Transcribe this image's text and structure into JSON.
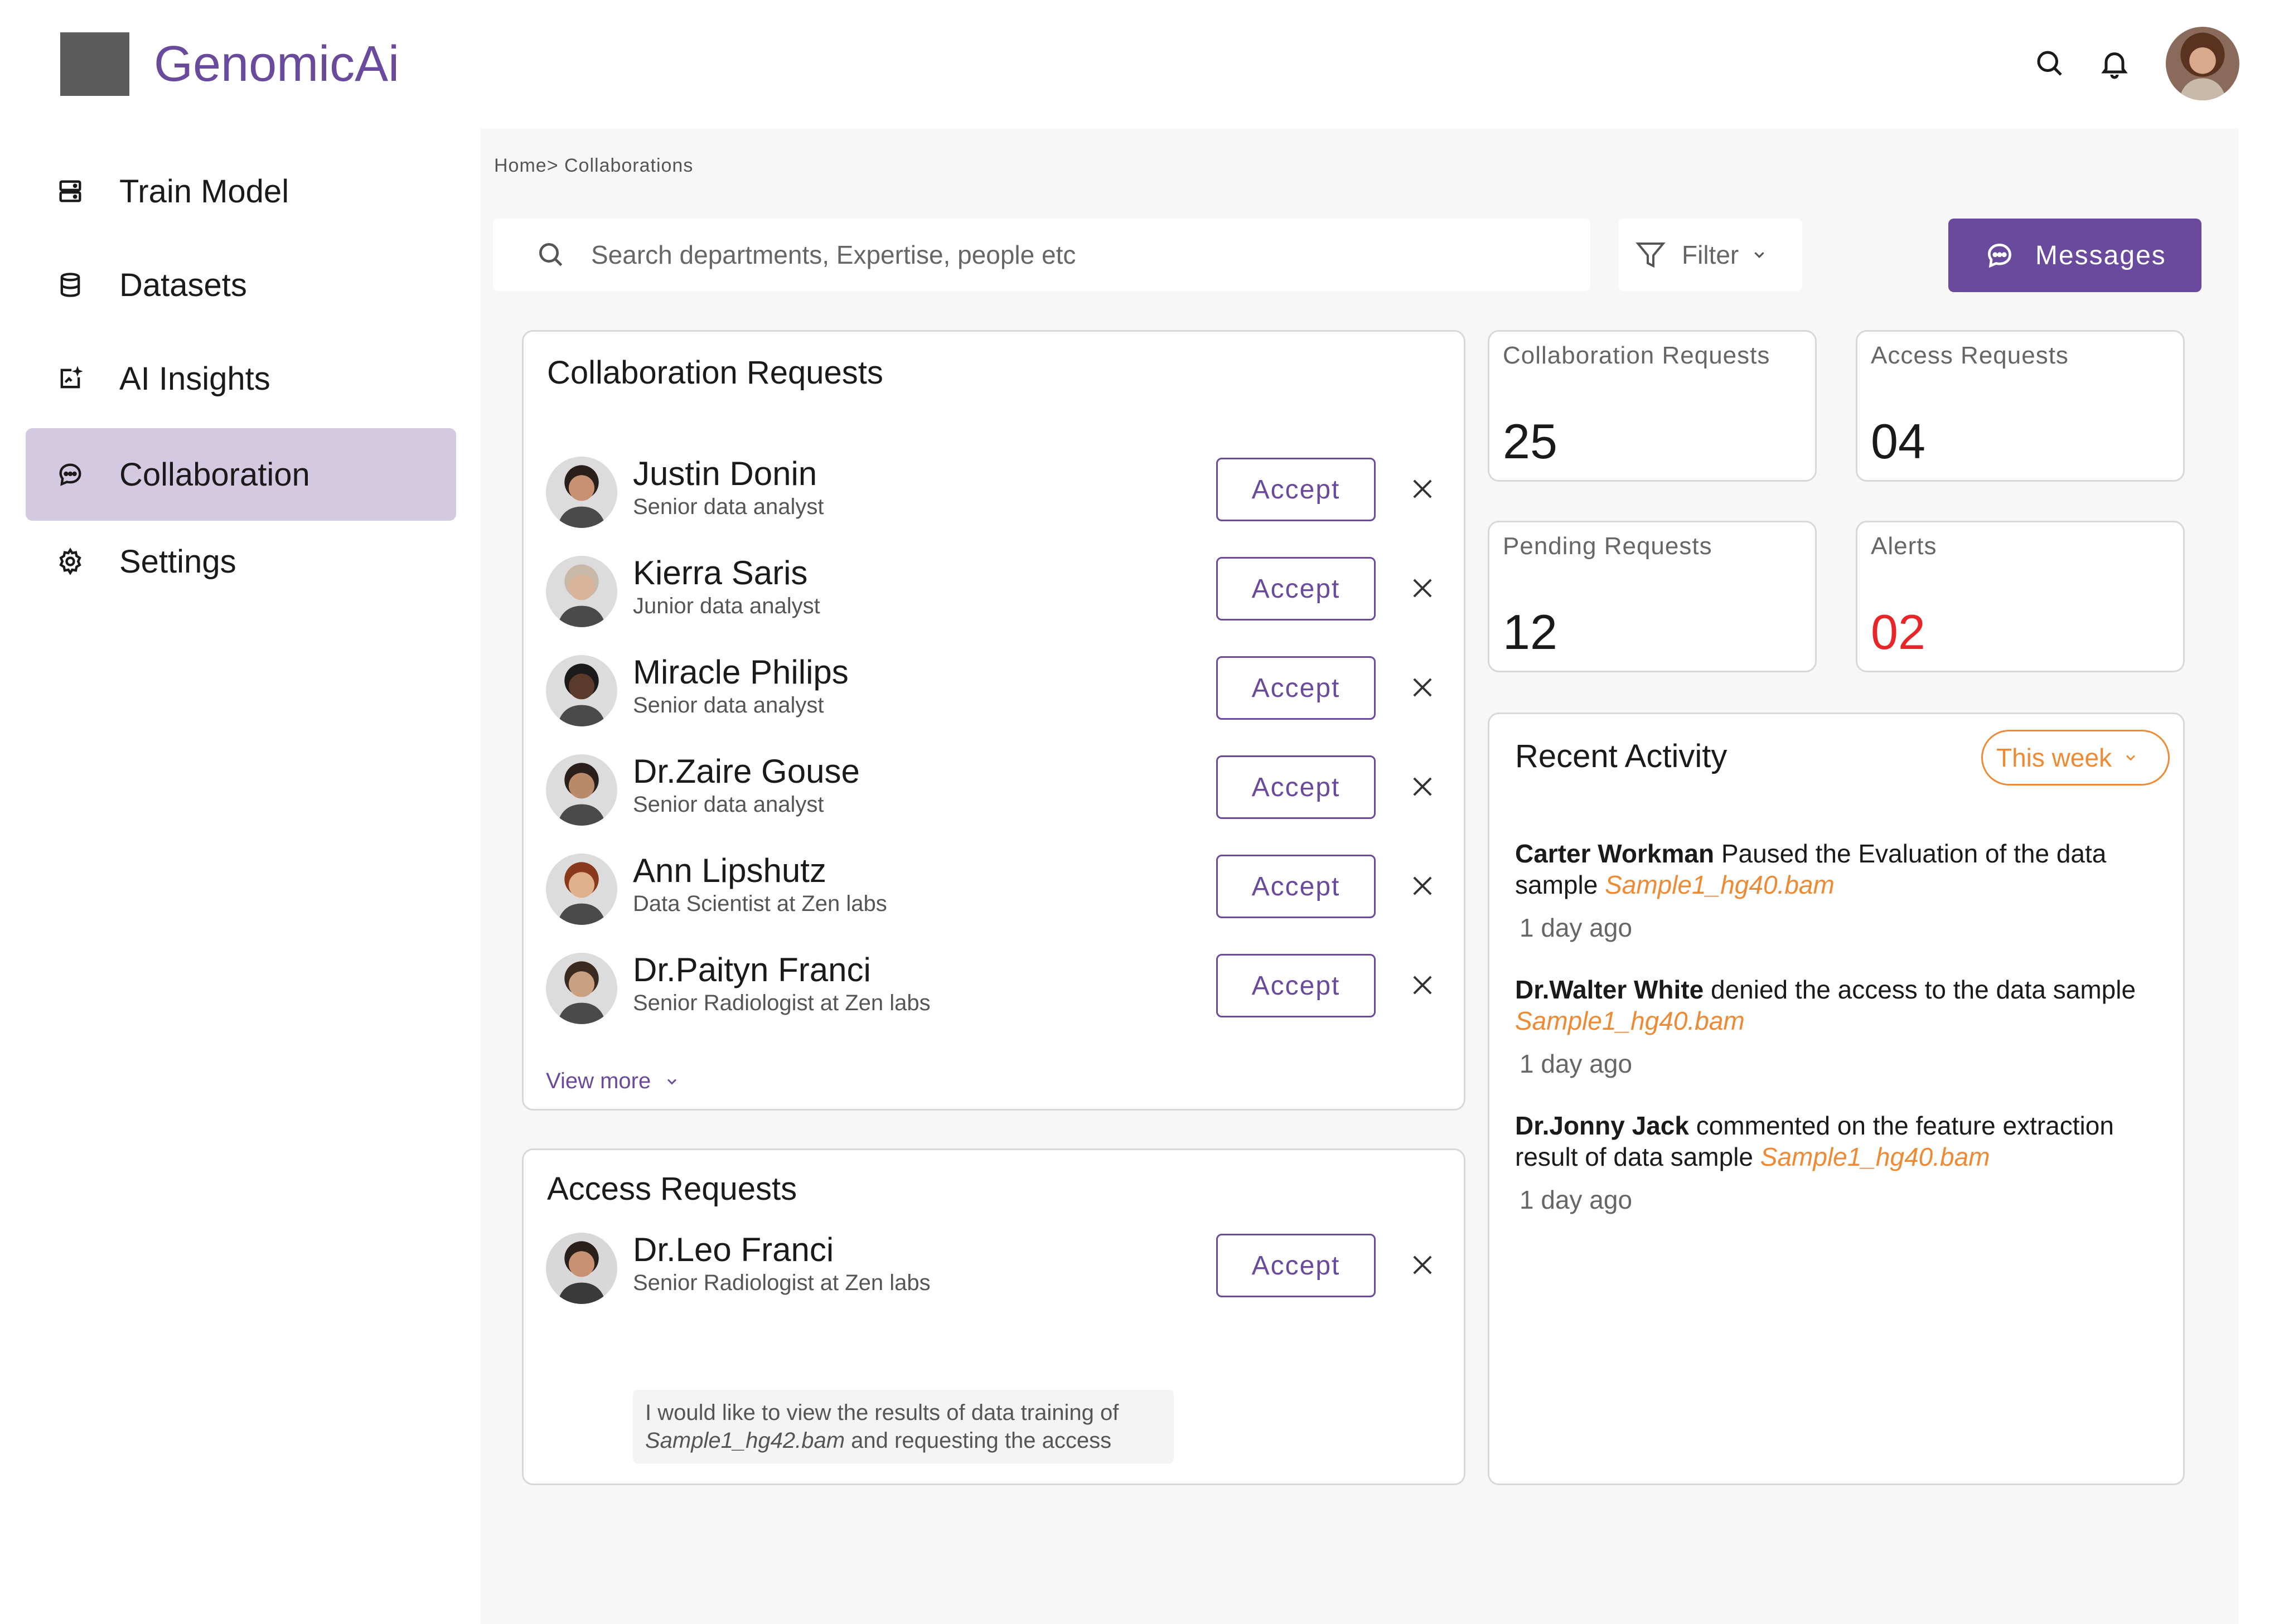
{
  "app": {
    "brand": "GenomicAi"
  },
  "sidebar": {
    "items": [
      {
        "label": "Train Model",
        "icon": "server-icon"
      },
      {
        "label": "Datasets",
        "icon": "database-icon"
      },
      {
        "label": "AI Insights",
        "icon": "insights-icon"
      },
      {
        "label": "Collaboration",
        "icon": "chat-icon",
        "active": true
      },
      {
        "label": "Settings",
        "icon": "gear-icon"
      }
    ]
  },
  "main": {
    "breadcrumb": "Home> Collaborations",
    "search_placeholder": "Search departments, Expertise, people etc",
    "filter_label": "Filter",
    "messages_label": "Messages"
  },
  "collab_requests": {
    "title": "Collaboration Requests",
    "accept_label": "Accept",
    "view_more": "View more",
    "items": [
      {
        "name": "Justin Donin",
        "role": "Senior data analyst"
      },
      {
        "name": "Kierra Saris",
        "role": "Junior data analyst"
      },
      {
        "name": "Miracle Philips",
        "role": "Senior data analyst"
      },
      {
        "name": "Dr.Zaire Gouse",
        "role": "Senior data analyst"
      },
      {
        "name": "Ann Lipshutz",
        "role": "Data Scientist at Zen labs"
      },
      {
        "name": "Dr.Paityn Franci",
        "role": "Senior Radiologist at Zen labs"
      }
    ]
  },
  "access_requests": {
    "title": "Access Requests",
    "item": {
      "name": "Dr.Leo Franci",
      "role": "Senior Radiologist at Zen labs",
      "note_line1": "I would like to view the results of data training of",
      "note_file": "Sample1_hg42.bam",
      "note_rest": " and requesting the access"
    }
  },
  "stats": [
    {
      "label": "Collaboration Requests",
      "value": "25"
    },
    {
      "label": "Access Requests",
      "value": "04"
    },
    {
      "label": "Pending Requests",
      "value": "12"
    },
    {
      "label": "Alerts",
      "value": "02"
    }
  ],
  "recent_activity": {
    "title": "Recent Activity",
    "range": "This week",
    "items": [
      {
        "actor": "Carter Workman",
        "text": " Paused the Evaluation of the data sample ",
        "file": "Sample1_hg40.bam",
        "time": "1 day ago"
      },
      {
        "actor": "Dr.Walter White",
        "text": " denied the access to the data sample ",
        "file": "Sample1_hg40.bam",
        "time": "1 day ago"
      },
      {
        "actor": "Dr.Jonny Jack",
        "text": " commented on the feature extraction result of data sample ",
        "file": "Sample1_hg40.bam",
        "time": "1 day ago"
      }
    ]
  },
  "colors": {
    "accent": "#6a4a9c",
    "active_bg": "#d3cae1",
    "orange": "#ee8a33",
    "alert": "#e8262a"
  }
}
